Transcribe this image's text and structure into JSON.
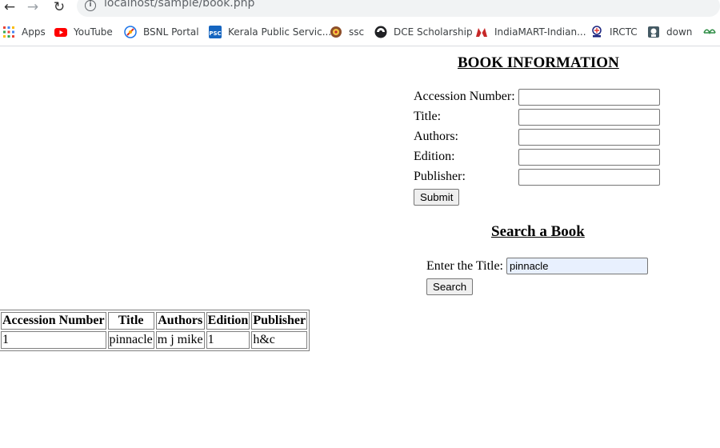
{
  "browser": {
    "url": "localhost/sample/book.php",
    "bookmarks": [
      {
        "label": "Apps",
        "icon": "apps-grid-icon"
      },
      {
        "label": "YouTube",
        "icon": "youtube-icon"
      },
      {
        "label": "BSNL Portal",
        "icon": "bsnl-icon"
      },
      {
        "label": "Kerala Public Servic...",
        "icon": "kpsc-icon"
      },
      {
        "label": "ssc",
        "icon": "ssc-icon"
      },
      {
        "label": "DCE Scholarship",
        "icon": "dce-icon"
      },
      {
        "label": "IndiaMART-Indian...",
        "icon": "indiamart-icon"
      },
      {
        "label": "IRCTC",
        "icon": "irctc-icon"
      },
      {
        "label": "down",
        "icon": "down-icon"
      }
    ]
  },
  "book_form": {
    "heading": "BOOK INFORMATION",
    "fields": [
      {
        "label": "Accession Number:",
        "value": ""
      },
      {
        "label": "Title:",
        "value": ""
      },
      {
        "label": "Authors:",
        "value": ""
      },
      {
        "label": "Edition:",
        "value": ""
      },
      {
        "label": "Publisher:",
        "value": ""
      }
    ],
    "submit_label": "Submit"
  },
  "search": {
    "heading": "Search a Book",
    "label": "Enter the Title:",
    "value": "pinnacle",
    "button_label": "Search"
  },
  "results": {
    "headers": [
      "Accession Number",
      "Title",
      "Authors",
      "Edition",
      "Publisher"
    ],
    "rows": [
      [
        "1",
        "pinnacle",
        "m j mike",
        "1",
        "h&c"
      ]
    ]
  }
}
